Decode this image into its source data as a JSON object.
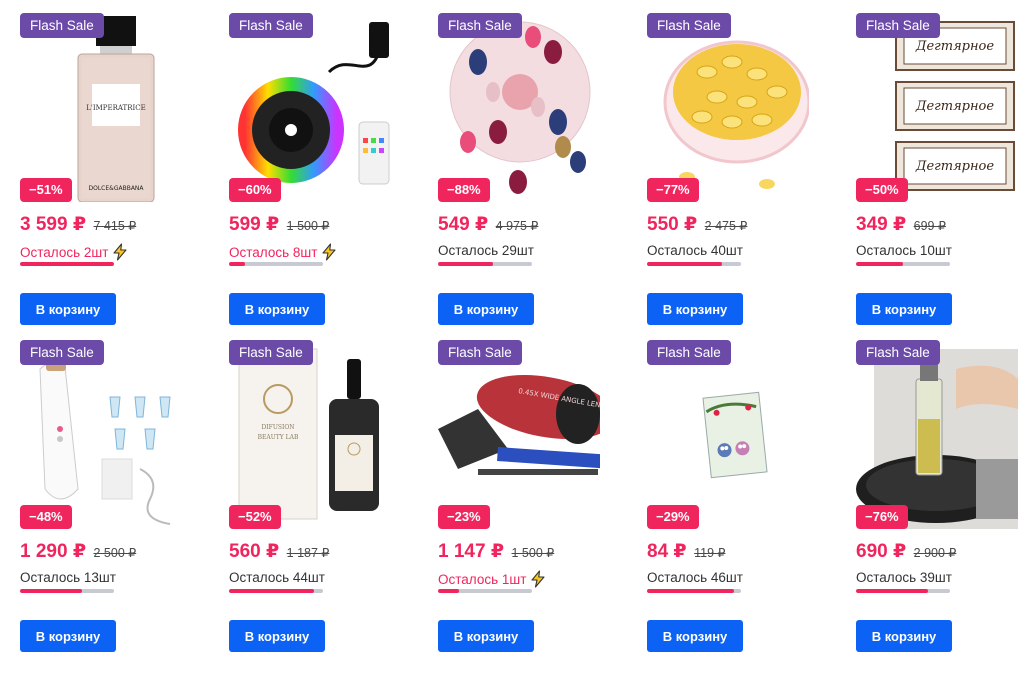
{
  "currency": "₽",
  "cart_label": "В корзину",
  "flash_label": "Flash Sale",
  "colors": {
    "accent": "#f0255e",
    "flash": "#6b4aa8",
    "button": "#0b62f5",
    "bar_bg": "#c7c9d3"
  },
  "products": [
    {
      "image": "perfume-bottle",
      "discount": "−51%",
      "price": "3 599 ₽",
      "old_price": "7 415 ₽",
      "stock": "Осталось 2шт",
      "low": true,
      "stock_fraction": 1.0
    },
    {
      "image": "led-strip",
      "discount": "−60%",
      "price": "599 ₽",
      "old_price": "1 500 ₽",
      "stock": "Осталось 8шт",
      "low": true,
      "stock_fraction": 0.17
    },
    {
      "image": "serum-capsules",
      "discount": "−88%",
      "price": "549 ₽",
      "old_price": "4 975 ₽",
      "stock": "Осталось 29шт",
      "low": false,
      "stock_fraction": 0.58
    },
    {
      "image": "oil-capsules",
      "discount": "−77%",
      "price": "550 ₽",
      "old_price": "2 475 ₽",
      "stock": "Осталось 40шт",
      "low": false,
      "stock_fraction": 0.8
    },
    {
      "image": "tar-soap",
      "discount": "−50%",
      "price": "349 ₽",
      "old_price": "699 ₽",
      "stock": "Осталось 10шт",
      "low": false,
      "stock_fraction": 0.5
    },
    {
      "image": "pore-vacuum",
      "discount": "−48%",
      "price": "1 290 ₽",
      "old_price": "2 500 ₽",
      "stock": "Осталось 13шт",
      "low": false,
      "stock_fraction": 0.66
    },
    {
      "image": "usma-oil",
      "discount": "−52%",
      "price": "560 ₽",
      "old_price": "1 187 ₽",
      "stock": "Осталось 44шт",
      "low": false,
      "stock_fraction": 0.9
    },
    {
      "image": "phone-lens",
      "discount": "−23%",
      "price": "1 147 ₽",
      "old_price": "1 500 ₽",
      "stock": "Осталось 1шт",
      "low": true,
      "stock_fraction": 0.22
    },
    {
      "image": "notebook",
      "discount": "−29%",
      "price": "84 ₽",
      "old_price": "119 ₽",
      "stock": "Осталось 46шт",
      "low": false,
      "stock_fraction": 0.93
    },
    {
      "image": "oil-sprayer",
      "discount": "−76%",
      "price": "690 ₽",
      "old_price": "2 900 ₽",
      "stock": "Осталось 39шт",
      "low": false,
      "stock_fraction": 0.77
    }
  ]
}
